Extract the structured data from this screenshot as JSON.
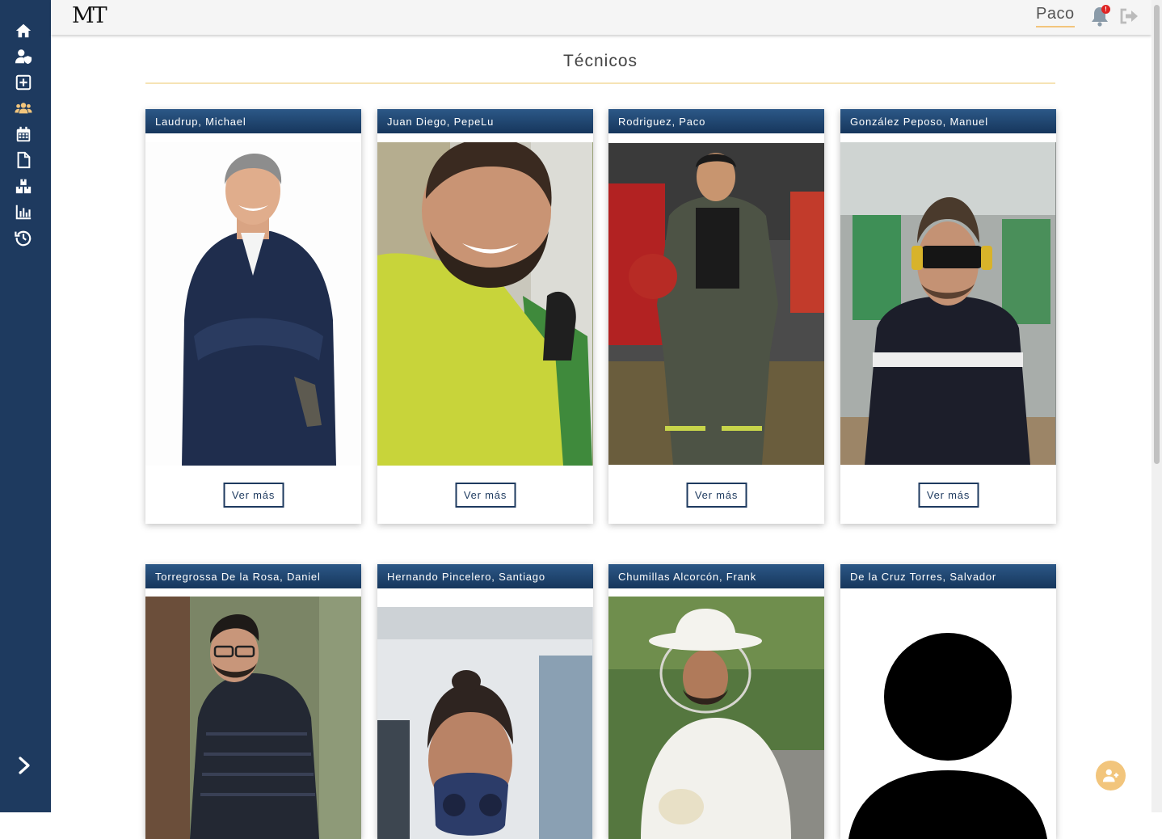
{
  "app": {
    "logo_text": "MT"
  },
  "topbar": {
    "user_name": "Paco",
    "notification_count": "!"
  },
  "sidebar": {
    "items": [
      {
        "icon": "home-icon"
      },
      {
        "icon": "user-shield-icon"
      },
      {
        "icon": "plus-square-icon"
      },
      {
        "icon": "users-icon",
        "active": true
      },
      {
        "icon": "calendar-icon"
      },
      {
        "icon": "file-icon"
      },
      {
        "icon": "boxes-icon"
      },
      {
        "icon": "bar-chart-icon"
      },
      {
        "icon": "history-icon"
      }
    ],
    "expand_icon": "chevron-right-icon"
  },
  "page": {
    "title": "Técnicos"
  },
  "technicians": [
    {
      "name": "Laudrup, Michael",
      "button": "Ver más"
    },
    {
      "name": "Juan Diego, PepeLu",
      "button": "Ver más"
    },
    {
      "name": "Rodriguez, Paco",
      "button": "Ver más"
    },
    {
      "name": "González Peposo, Manuel",
      "button": "Ver más"
    },
    {
      "name": "Torregrossa De la Rosa, Daniel"
    },
    {
      "name": "Hernando Pincelero, Santiago"
    },
    {
      "name": "Chumillas Alcorcón, Frank"
    },
    {
      "name": "De la Cruz Torres, Salvador"
    }
  ],
  "colors": {
    "sidebar": "#1e3a5f",
    "accent": "#f2c57c",
    "header_gradient_top": "#2c5887",
    "header_gradient_bottom": "#16365c"
  }
}
